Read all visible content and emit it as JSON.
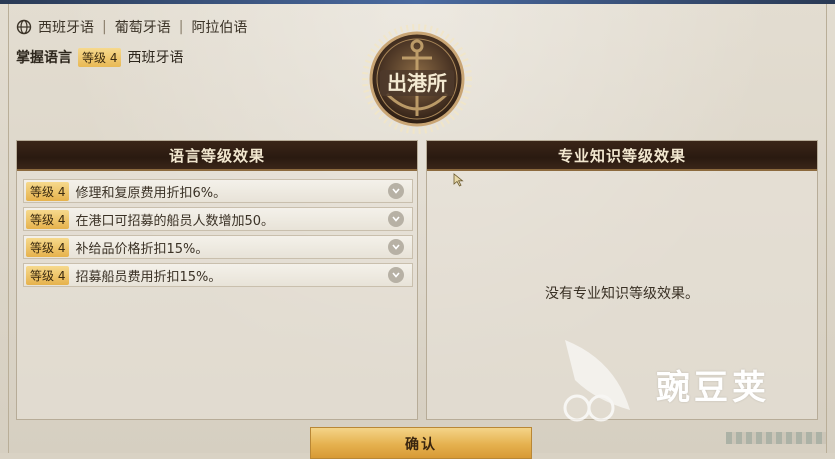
{
  "header": {
    "languages": [
      "西班牙语",
      "葡萄牙语",
      "阿拉伯语"
    ],
    "mastery_label": "掌握语言",
    "mastery_level": "等级 4",
    "mastery_language": "西班牙语",
    "emblem_text": "出港所"
  },
  "left_panel": {
    "title": "语言等级效果",
    "items": [
      {
        "level": "等级 4",
        "text": "修理和复原费用折扣6%。"
      },
      {
        "level": "等级 4",
        "text": "在港口可招募的船员人数增加50。"
      },
      {
        "level": "等级 4",
        "text": "补给品价格折扣15%。"
      },
      {
        "level": "等级 4",
        "text": "招募船员费用折扣15%。"
      }
    ]
  },
  "right_panel": {
    "title": "专业知识等级效果",
    "empty_message": "没有专业知识等级效果。"
  },
  "footer": {
    "confirm_label": "确认"
  },
  "watermark": {
    "text": "豌豆荚"
  },
  "colors": {
    "panel_header": "#2a1a10",
    "badge_gold": "#e9b954",
    "confirm_gold": "#e5b14f"
  }
}
